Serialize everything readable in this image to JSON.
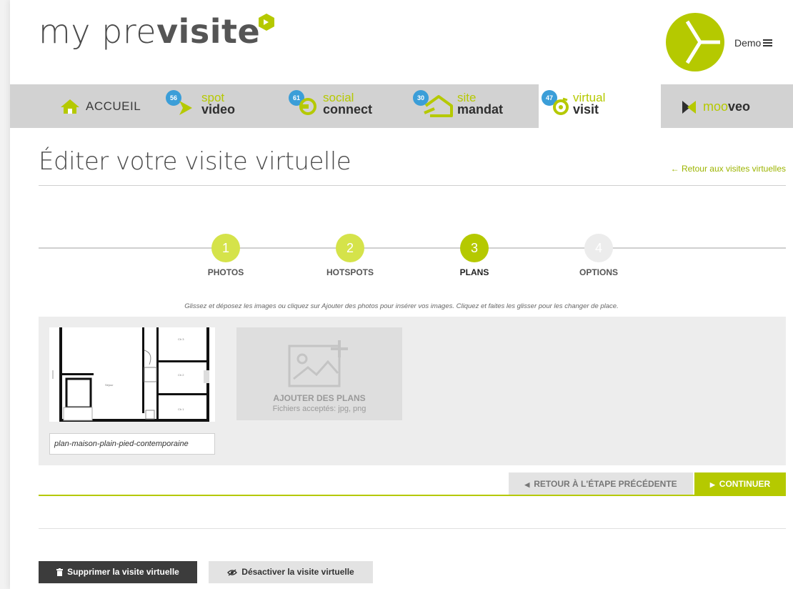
{
  "header": {
    "logo_light": "my pre",
    "logo_bold": "visite",
    "user_label": "Demo",
    "brand_color": "#b5c900",
    "badge_color": "#3b9ed8"
  },
  "nav": {
    "home_label": "ACCUEIL",
    "products": [
      {
        "top": "spot",
        "bottom": "video",
        "badge": "56",
        "icon": "play-arrow-icon"
      },
      {
        "top": "social",
        "bottom": "connect",
        "badge": "61",
        "icon": "connect-circle-icon"
      },
      {
        "top": "site",
        "bottom": "mandat",
        "badge": "30",
        "icon": "house-icon"
      },
      {
        "top": "virtual",
        "bottom": "visit",
        "badge": "47",
        "icon": "eye-circle-icon",
        "active": true
      }
    ],
    "mooveo_light": "moo",
    "mooveo_bold": "veo"
  },
  "page": {
    "title": "Éditer votre visite virtuelle",
    "back_link": "← Retour aux visites virtuelles"
  },
  "stepper": {
    "steps": [
      {
        "num": "1",
        "label": "PHOTOS",
        "state": "done"
      },
      {
        "num": "2",
        "label": "HOTSPOTS",
        "state": "done"
      },
      {
        "num": "3",
        "label": "PLANS",
        "state": "current"
      },
      {
        "num": "4",
        "label": "OPTIONS",
        "state": "todo"
      }
    ]
  },
  "upload": {
    "hint": "Glissez et déposez les images ou cliquez sur Ajouter des photos pour insérer vos images. Cliquez et faites les glisser pour les changer de place.",
    "plan_filename": "plan-maison-plain-pied-contemporaine",
    "add_title": "AJOUTER DES PLANS",
    "add_subtitle": "Fichiers acceptés: jpg, png"
  },
  "actions": {
    "prev_label": "RETOUR À L'ÉTAPE PRÉCÉDENTE",
    "next_label": "CONTINUER",
    "delete_label": "Supprimer la visite virtuelle",
    "deactivate_label": "Désactiver la visite virtuelle"
  }
}
